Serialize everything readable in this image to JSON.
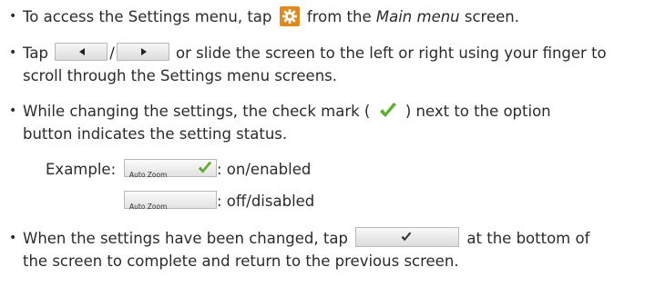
{
  "bullets": {
    "one": {
      "before": "To access the Settings menu, tap ",
      "after_icon": " from the ",
      "em": "Main menu",
      "after_em": " screen."
    },
    "two": {
      "before": "Tap ",
      "slash": "/",
      "after": " or slide the screen to the left or right using your finger to",
      "line2": "scroll through the Settings menu screens."
    },
    "three": {
      "line1_before": "While changing the settings, the check mark ( ",
      "line1_after": " ) next to the option",
      "line2": "button indicates the setting status."
    },
    "four": {
      "line1_before": "When the settings have been changed, tap ",
      "line1_after": " at the bottom of",
      "line2": "the screen to complete and return to the previous screen."
    }
  },
  "example": {
    "label": "Example:",
    "on_button": "Auto Zoom",
    "on_text": ": on/enabled",
    "off_button": "Auto Zoom",
    "off_text": ": off/disabled"
  },
  "icons": {
    "settings": "gear-icon",
    "prev": "left-arrow-icon",
    "next": "right-arrow-icon",
    "check": "check-mark-icon"
  },
  "colors": {
    "gear_bg": "#e08a1e",
    "check": "#5fae2e",
    "text": "#2b2b2b"
  }
}
